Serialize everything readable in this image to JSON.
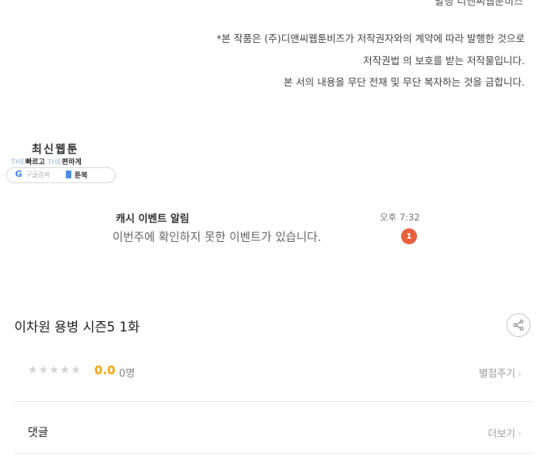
{
  "copyright": {
    "publisher": "발행 디앤씨웹툰비즈",
    "lines": [
      "*본 작품은 (주)디앤씨웹툰비즈가 저작권자와의 계약에 따라 발행한 것으로",
      "저작권법 의 보호를 받는 저작물입니다.",
      "본 서의 내용을 무단 전재 및 무단 복자하는 것을 금합니다."
    ]
  },
  "banner": {
    "title": "최신웹툰",
    "slogan_the_1": "THE",
    "slogan_word_1": "빠르고",
    "slogan_the_2": "THE",
    "slogan_word_2": "편하게",
    "search_icon_letter": "G",
    "search_label": "구글검색",
    "book_label": "툰북"
  },
  "notification": {
    "title": "캐시 이벤트 알림",
    "time": "오후 7:32",
    "message": "이번주에 확인하지 못한 이벤트가 있습니다.",
    "badge_count": "1",
    "badge_color": "#e8613e"
  },
  "episode": {
    "title": "이차원 용병 시즌5 1화"
  },
  "rating": {
    "stars": "★★★★★",
    "value": "0.0",
    "count": "0명",
    "rate_label": "별점주기",
    "accent_color": "#f5a50b"
  },
  "comments": {
    "label": "댓글",
    "more_label": "더보기"
  },
  "icons": {
    "share": "share-icon",
    "chevron": "chevron-right-icon"
  }
}
